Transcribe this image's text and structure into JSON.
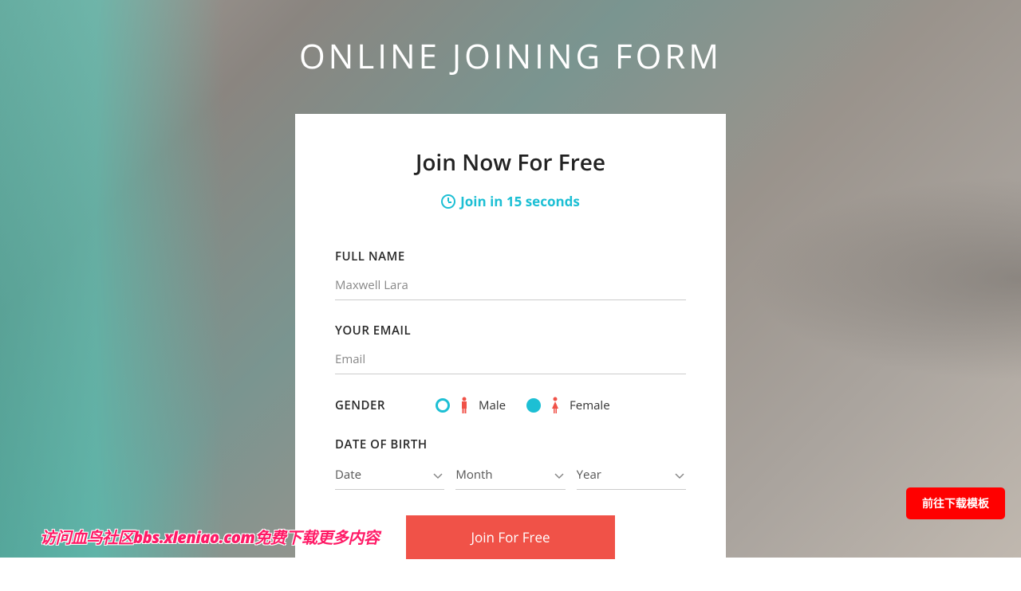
{
  "page": {
    "title": "ONLINE JOINING FORM"
  },
  "card": {
    "title": "Join Now For Free",
    "subtitle": "Join in 15 seconds"
  },
  "form": {
    "fullname_label": "FULL NAME",
    "fullname_placeholder": "Maxwell Lara",
    "email_label": "YOUR EMAIL",
    "email_placeholder": "Email",
    "gender_label": "GENDER",
    "male_label": "Male",
    "female_label": "Female",
    "dob_label": "DATE OF BIRTH",
    "date_option": "Date",
    "month_option": "Month",
    "year_option": "Year",
    "submit_label": "Join For Free"
  },
  "footer": {
    "download_btn": "前往下载模板",
    "watermark": "访问血鸟社区bbs.xleniao.com免费下载更多内容"
  },
  "colors": {
    "accent": "#1dbfd4",
    "danger": "#f05248"
  }
}
